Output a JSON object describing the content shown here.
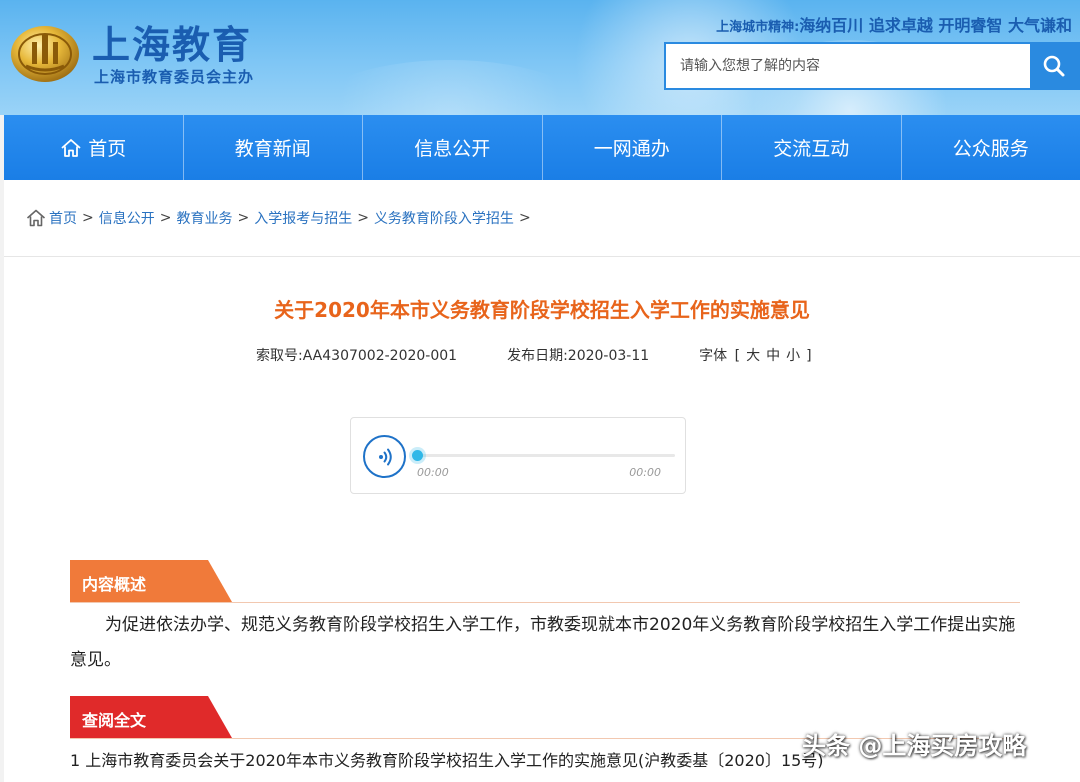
{
  "header": {
    "site_title": "上海教育",
    "site_subtitle": "上海市教育委员会主办",
    "spirit_label": "上海城市精神:",
    "spirit_text": "海纳百川 追求卓越 开明睿智 大气谦和",
    "search": {
      "placeholder": "请输入您想了解的内容",
      "value": ""
    }
  },
  "nav": {
    "items": [
      {
        "label": "首页",
        "icon": "home-icon"
      },
      {
        "label": "教育新闻"
      },
      {
        "label": "信息公开"
      },
      {
        "label": "一网通办"
      },
      {
        "label": "交流互动"
      },
      {
        "label": "公众服务"
      }
    ]
  },
  "breadcrumb": {
    "icon": "home-icon",
    "items": [
      "首页",
      "信息公开",
      "教育业务",
      "入学报考与招生",
      "义务教育阶段入学招生"
    ],
    "separator": ">"
  },
  "article": {
    "title": "关于2020年本市义务教育阶段学校招生入学工作的实施意见",
    "index_label": "索取号:",
    "index_value": "AA4307002-2020-001",
    "date_label": "发布日期:",
    "date_value": "2020-03-11",
    "font_label": "字体",
    "font_open": "[",
    "font_large": "大",
    "font_medium": "中",
    "font_small": "小",
    "font_close": "]"
  },
  "audio": {
    "current_time": "00:00",
    "duration": "00:00",
    "progress": 0
  },
  "sections": {
    "summary_label": "内容概述",
    "summary_text": "为促进依法办学、规范义务教育阶段学校招生入学工作，市教委现就本市2020年义务教育阶段学校招生入学工作提出实施意见。",
    "fulltext_label": "查阅全文",
    "document_link": "1 上海市教育委员会关于2020年本市义务教育阶段学校招生入学工作的实施意见(沪教委基〔2020〕15号)"
  },
  "watermark": "头条 @上海买房攻略",
  "colors": {
    "accent_blue": "#1a7ee6",
    "title_orange": "#e8641b",
    "summary_tag": "#f07a3a",
    "fulltext_tag": "#e02a2a",
    "link_blue": "#2a72c0"
  }
}
